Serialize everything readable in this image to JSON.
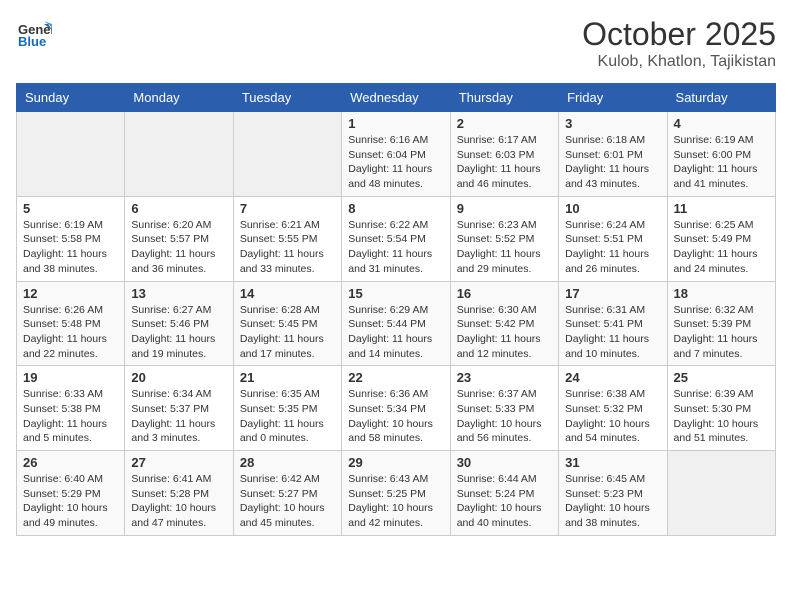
{
  "header": {
    "logo_general": "General",
    "logo_blue": "Blue",
    "month_title": "October 2025",
    "location": "Kulob, Khatlon, Tajikistan"
  },
  "weekdays": [
    "Sunday",
    "Monday",
    "Tuesday",
    "Wednesday",
    "Thursday",
    "Friday",
    "Saturday"
  ],
  "weeks": [
    [
      {
        "day": "",
        "info": ""
      },
      {
        "day": "",
        "info": ""
      },
      {
        "day": "",
        "info": ""
      },
      {
        "day": "1",
        "info": "Sunrise: 6:16 AM\nSunset: 6:04 PM\nDaylight: 11 hours and 48 minutes."
      },
      {
        "day": "2",
        "info": "Sunrise: 6:17 AM\nSunset: 6:03 PM\nDaylight: 11 hours and 46 minutes."
      },
      {
        "day": "3",
        "info": "Sunrise: 6:18 AM\nSunset: 6:01 PM\nDaylight: 11 hours and 43 minutes."
      },
      {
        "day": "4",
        "info": "Sunrise: 6:19 AM\nSunset: 6:00 PM\nDaylight: 11 hours and 41 minutes."
      }
    ],
    [
      {
        "day": "5",
        "info": "Sunrise: 6:19 AM\nSunset: 5:58 PM\nDaylight: 11 hours and 38 minutes."
      },
      {
        "day": "6",
        "info": "Sunrise: 6:20 AM\nSunset: 5:57 PM\nDaylight: 11 hours and 36 minutes."
      },
      {
        "day": "7",
        "info": "Sunrise: 6:21 AM\nSunset: 5:55 PM\nDaylight: 11 hours and 33 minutes."
      },
      {
        "day": "8",
        "info": "Sunrise: 6:22 AM\nSunset: 5:54 PM\nDaylight: 11 hours and 31 minutes."
      },
      {
        "day": "9",
        "info": "Sunrise: 6:23 AM\nSunset: 5:52 PM\nDaylight: 11 hours and 29 minutes."
      },
      {
        "day": "10",
        "info": "Sunrise: 6:24 AM\nSunset: 5:51 PM\nDaylight: 11 hours and 26 minutes."
      },
      {
        "day": "11",
        "info": "Sunrise: 6:25 AM\nSunset: 5:49 PM\nDaylight: 11 hours and 24 minutes."
      }
    ],
    [
      {
        "day": "12",
        "info": "Sunrise: 6:26 AM\nSunset: 5:48 PM\nDaylight: 11 hours and 22 minutes."
      },
      {
        "day": "13",
        "info": "Sunrise: 6:27 AM\nSunset: 5:46 PM\nDaylight: 11 hours and 19 minutes."
      },
      {
        "day": "14",
        "info": "Sunrise: 6:28 AM\nSunset: 5:45 PM\nDaylight: 11 hours and 17 minutes."
      },
      {
        "day": "15",
        "info": "Sunrise: 6:29 AM\nSunset: 5:44 PM\nDaylight: 11 hours and 14 minutes."
      },
      {
        "day": "16",
        "info": "Sunrise: 6:30 AM\nSunset: 5:42 PM\nDaylight: 11 hours and 12 minutes."
      },
      {
        "day": "17",
        "info": "Sunrise: 6:31 AM\nSunset: 5:41 PM\nDaylight: 11 hours and 10 minutes."
      },
      {
        "day": "18",
        "info": "Sunrise: 6:32 AM\nSunset: 5:39 PM\nDaylight: 11 hours and 7 minutes."
      }
    ],
    [
      {
        "day": "19",
        "info": "Sunrise: 6:33 AM\nSunset: 5:38 PM\nDaylight: 11 hours and 5 minutes."
      },
      {
        "day": "20",
        "info": "Sunrise: 6:34 AM\nSunset: 5:37 PM\nDaylight: 11 hours and 3 minutes."
      },
      {
        "day": "21",
        "info": "Sunrise: 6:35 AM\nSunset: 5:35 PM\nDaylight: 11 hours and 0 minutes."
      },
      {
        "day": "22",
        "info": "Sunrise: 6:36 AM\nSunset: 5:34 PM\nDaylight: 10 hours and 58 minutes."
      },
      {
        "day": "23",
        "info": "Sunrise: 6:37 AM\nSunset: 5:33 PM\nDaylight: 10 hours and 56 minutes."
      },
      {
        "day": "24",
        "info": "Sunrise: 6:38 AM\nSunset: 5:32 PM\nDaylight: 10 hours and 54 minutes."
      },
      {
        "day": "25",
        "info": "Sunrise: 6:39 AM\nSunset: 5:30 PM\nDaylight: 10 hours and 51 minutes."
      }
    ],
    [
      {
        "day": "26",
        "info": "Sunrise: 6:40 AM\nSunset: 5:29 PM\nDaylight: 10 hours and 49 minutes."
      },
      {
        "day": "27",
        "info": "Sunrise: 6:41 AM\nSunset: 5:28 PM\nDaylight: 10 hours and 47 minutes."
      },
      {
        "day": "28",
        "info": "Sunrise: 6:42 AM\nSunset: 5:27 PM\nDaylight: 10 hours and 45 minutes."
      },
      {
        "day": "29",
        "info": "Sunrise: 6:43 AM\nSunset: 5:25 PM\nDaylight: 10 hours and 42 minutes."
      },
      {
        "day": "30",
        "info": "Sunrise: 6:44 AM\nSunset: 5:24 PM\nDaylight: 10 hours and 40 minutes."
      },
      {
        "day": "31",
        "info": "Sunrise: 6:45 AM\nSunset: 5:23 PM\nDaylight: 10 hours and 38 minutes."
      },
      {
        "day": "",
        "info": ""
      }
    ]
  ]
}
